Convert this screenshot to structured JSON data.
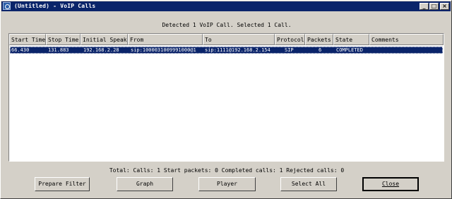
{
  "window": {
    "title": "(Untitled) - VoIP Calls"
  },
  "titlebar_buttons": {
    "minimize": "_",
    "maximize": "□",
    "close": "×"
  },
  "summary": "Detected 1 VoIP Call. Selected 1 Call.",
  "table": {
    "columns": [
      "Start Time",
      "Stop Time",
      "Initial Speaker",
      "From",
      "To",
      "Protocol",
      "Packets",
      "State",
      "Comments"
    ],
    "rows": [
      [
        "66.430",
        "131.883",
        "192.168.2.28",
        "sip:1000031009991000@1",
        "sip:1111@192.168.2.154",
        "SIP",
        "6",
        "COMPLETED",
        ""
      ]
    ]
  },
  "stats": "Total: Calls: 1   Start packets: 0   Completed calls: 1   Rejected calls: 0",
  "buttons": {
    "prepare_filter": "Prepare Filter",
    "graph": "Graph",
    "player": "Player",
    "select_all": "Select All",
    "close": "Close"
  }
}
